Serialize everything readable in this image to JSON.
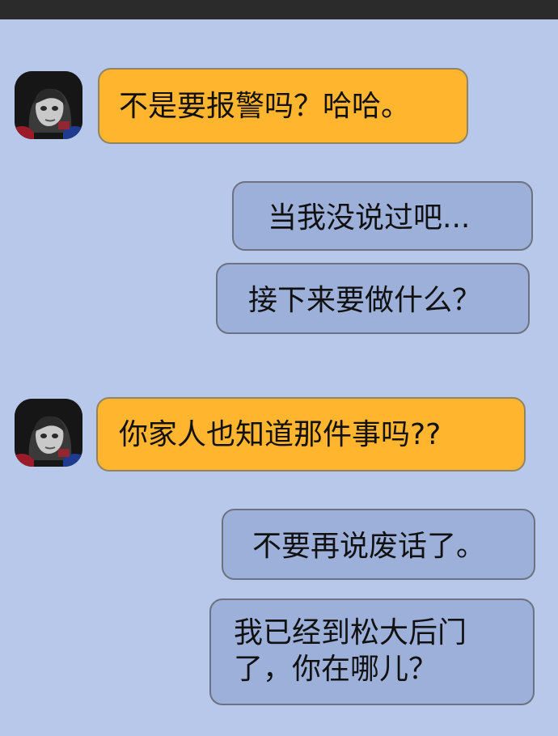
{
  "chat": {
    "messages": [
      {
        "side": "incoming",
        "text": "不是要报警吗？哈哈。"
      },
      {
        "side": "outgoing",
        "text": "当我没说过吧..."
      },
      {
        "side": "outgoing",
        "text": "接下来要做什么？"
      },
      {
        "side": "incoming",
        "text": "你家人也知道那件事吗??"
      },
      {
        "side": "outgoing",
        "text": "不要再说废话了。"
      },
      {
        "side": "outgoing",
        "text": "我已经到松大后门了，你在哪儿？"
      }
    ],
    "multiline_message_lines": [
      "我已经到松大后门",
      "了，你在哪儿？"
    ]
  },
  "colors": {
    "background": "#b8c8ea",
    "top_bar": "#2b2b2b",
    "incoming_bubble": "#ffb52e",
    "outgoing_bubble": "#9db0da"
  },
  "icons": {
    "avatar": "avatar-image"
  }
}
